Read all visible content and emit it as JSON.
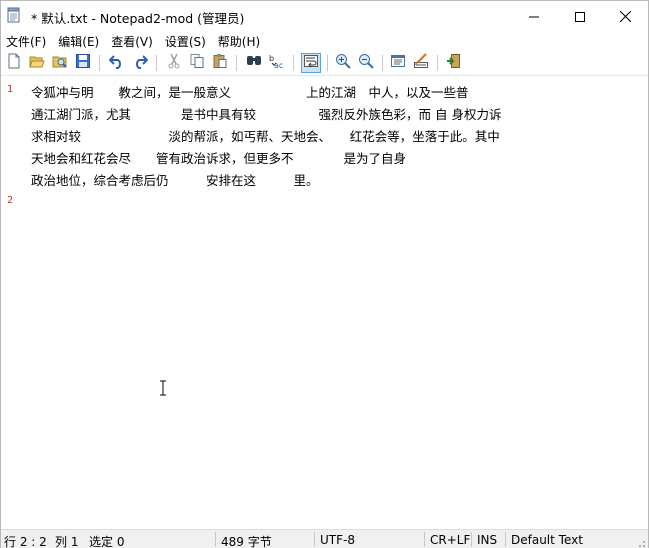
{
  "window": {
    "title": "* 默认.txt - Notepad2-mod (管理员)",
    "icon": "notepad-document-icon"
  },
  "menu": {
    "items": [
      "文件(F)",
      "编辑(E)",
      "查看(V)",
      "设置(S)",
      "帮助(H)"
    ]
  },
  "toolbar": {
    "buttons": [
      "new-file-icon",
      "open-file-icon",
      "browse-icon",
      "save-icon",
      "undo-icon",
      "redo-icon",
      "cut-icon",
      "copy-icon",
      "paste-icon",
      "find-icon",
      "replace-icon",
      "word-wrap-icon",
      "zoom-in-icon",
      "zoom-out-icon",
      "select-scheme-icon",
      "customize-scheme-icon",
      "exit-icon"
    ],
    "active": "word-wrap-icon"
  },
  "editor": {
    "line_numbers": [
      "1",
      "2"
    ],
    "lines": [
      "令狐冲与明　　教之间，是一般意义　　　　　　上的江湖　中人，以及一些普",
      "通江湖门派，尤其　　　　是书中具有较　　　　　强烈反外族色彩，而 自 身权力诉",
      "求相对较　　　　　　　淡的帮派，如丐帮、天地会、　　红花会等，坐落于此。其中",
      "天地会和红花会尽　　管有政治诉求，但更多不　　　　是为了自身",
      "政治地位，综合考虑后仍　　　安排在这　　　里。"
    ]
  },
  "status": {
    "position": "行 2 : 2",
    "column": "列 1",
    "selection": "选定 0",
    "size": "489 字节",
    "encoding": "UTF-8",
    "eol": "CR+LF",
    "mode": "INS",
    "scheme": "Default Text"
  }
}
